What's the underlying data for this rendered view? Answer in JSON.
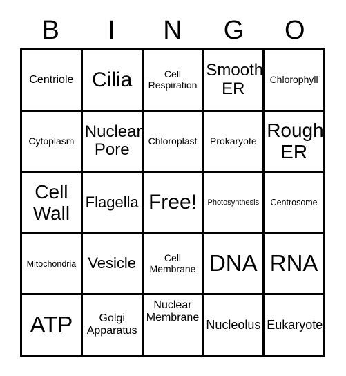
{
  "card": {
    "title": "Bingo Card",
    "header_letters": [
      "B",
      "I",
      "N",
      "G",
      "O"
    ],
    "rows": 5,
    "columns": 5,
    "border_color": "#000000",
    "background_color": "#ffffff",
    "text_color": "#000000",
    "cells": [
      [
        {
          "text": "Centriole",
          "size": "sz-m"
        },
        {
          "text": "Cilia",
          "size": "sz-h1"
        },
        {
          "text": "Cell\nRespiration",
          "size": "sz-sm"
        },
        {
          "text": "Smooth\nER",
          "size": "sz-xl"
        },
        {
          "text": "Chlorophyll",
          "size": "sz-sm"
        }
      ],
      [
        {
          "text": "Cytoplasm",
          "size": "sz-sm"
        },
        {
          "text": "Nuclear\nPore",
          "size": "sz-xl"
        },
        {
          "text": "Chloroplast",
          "size": "sz-sm"
        },
        {
          "text": "Prokaryote",
          "size": "sz-sm"
        },
        {
          "text": "Rough\nER",
          "size": "sz-xxl"
        }
      ],
      [
        {
          "text": "Cell\nWall",
          "size": "sz-xxl"
        },
        {
          "text": "Flagella",
          "size": "sz-l"
        },
        {
          "text": "Free!",
          "size": "sz-h1"
        },
        {
          "text": "Photosynthesis",
          "size": "sz-xs"
        },
        {
          "text": "Centrosome",
          "size": "sz-s"
        }
      ],
      [
        {
          "text": "Mitochondria",
          "size": "sz-s"
        },
        {
          "text": "Vesicle",
          "size": "sz-l"
        },
        {
          "text": "Cell\nMembrane",
          "size": "sz-sm"
        },
        {
          "text": "DNA",
          "size": "sz-h2"
        },
        {
          "text": "RNA",
          "size": "sz-h2"
        }
      ],
      [
        {
          "text": "ATP",
          "size": "sz-h2"
        },
        {
          "text": "Golgi\nApparatus",
          "size": "sz-m"
        },
        {
          "text": "Nuclear\nMembrane",
          "size": "sz-m",
          "valign": "top"
        },
        {
          "text": "Nucleolus",
          "size": "sz-ml"
        },
        {
          "text": "Eukaryote",
          "size": "sz-ml"
        }
      ]
    ]
  }
}
